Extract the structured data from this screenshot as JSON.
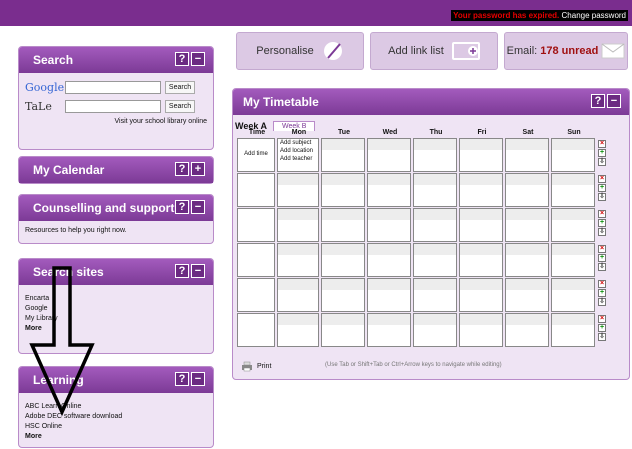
{
  "topbar": {
    "expired": "Your password has expired.",
    "change": "Change password"
  },
  "buttons": {
    "personalise": "Personalise",
    "add_link_list": "Add link list",
    "email_prefix": "Email:",
    "email_unread": "178 unread"
  },
  "search": {
    "title": "Search",
    "ctrl_help": "?",
    "ctrl_toggle": "−",
    "google": "Google",
    "tale": "TaLe",
    "btn": "Search",
    "visit": "Visit your school library online"
  },
  "calendar": {
    "title": "My Calendar",
    "ctrl_help": "?",
    "ctrl_toggle": "+"
  },
  "counselling": {
    "title": "Counselling and support?",
    "ctrl_help": "?",
    "ctrl_toggle": "−",
    "text": "Resources to help you right now."
  },
  "search_sites": {
    "title": "Search sites",
    "ctrl_help": "?",
    "ctrl_toggle": "−",
    "items": [
      "Encarta",
      "Google",
      "My Library",
      "More"
    ]
  },
  "learning": {
    "title": "Learning",
    "ctrl_help": "?",
    "ctrl_toggle": "−",
    "items": [
      "ABC Learn Online",
      "Adobe DEC software download",
      "HSC Online",
      "More"
    ]
  },
  "timetable": {
    "title": "My Timetable",
    "ctrl_help": "?",
    "ctrl_toggle": "−",
    "week_a": "Week A",
    "week_b": "Week B",
    "headers": [
      "Time",
      "Mon",
      "Tue",
      "Wed",
      "Thu",
      "Fri",
      "Sat",
      "Sun"
    ],
    "add_time": "Add time",
    "add_subject": "Add subject",
    "add_location": "Add location",
    "add_teacher": "Add teacher",
    "print": "Print",
    "hint": "(Use Tab or Shift+Tab or Ctrl+Arrow keys to navigate while editing)"
  },
  "colors": {
    "accent": "#7c3a96",
    "panel": "#efe4f4"
  }
}
